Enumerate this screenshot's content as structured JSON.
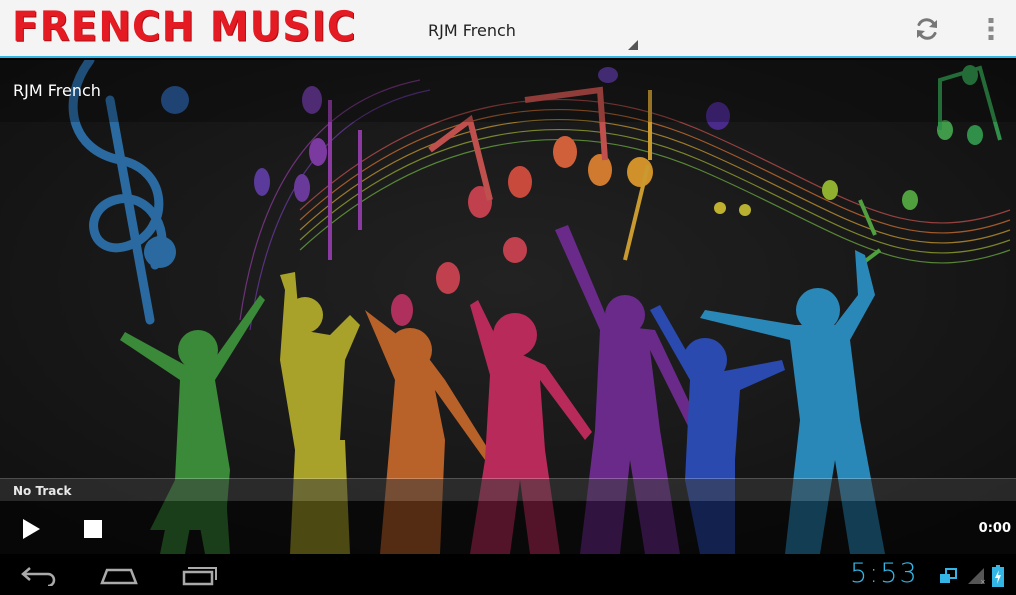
{
  "app": {
    "logo_text": "FRENCH MUSIC",
    "logo_color": "#e41b23",
    "accent_color": "#33b5e5"
  },
  "action_bar": {
    "station_selector": {
      "selected": "RJM French"
    },
    "actions": [
      {
        "name": "refresh-icon"
      },
      {
        "name": "overflow-menu-icon"
      }
    ]
  },
  "content": {
    "station_name": "RJM French",
    "artwork": "colorful dancers silhouettes with music notes"
  },
  "player": {
    "track_title": "No Track",
    "time": "0:00",
    "controls": [
      {
        "name": "play-icon"
      },
      {
        "name": "stop-icon"
      }
    ]
  },
  "system_bar": {
    "nav": [
      {
        "name": "back-icon"
      },
      {
        "name": "home-icon"
      },
      {
        "name": "recent-apps-icon"
      }
    ],
    "clock": "5:53",
    "status_icons": [
      "screen-share-icon",
      "signal-icon",
      "battery-charging-icon"
    ]
  }
}
